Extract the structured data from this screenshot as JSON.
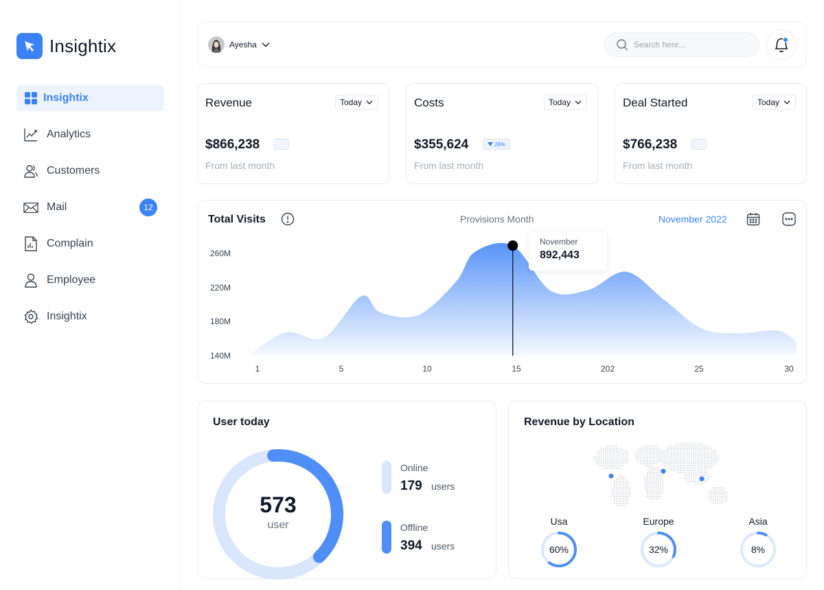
{
  "app": {
    "title": "Insightix"
  },
  "sidebar": {
    "items": [
      {
        "label": "Insightix",
        "icon": "grid-icon",
        "active": true
      },
      {
        "label": "Analytics",
        "icon": "chart-line-icon"
      },
      {
        "label": "Customers",
        "icon": "users-icon"
      },
      {
        "label": "Mail",
        "icon": "mail-icon",
        "badge": "12"
      },
      {
        "label": "Complain",
        "icon": "document-icon"
      },
      {
        "label": "Employee",
        "icon": "user-icon"
      },
      {
        "label": "Insightix",
        "icon": "gear-icon"
      }
    ]
  },
  "topbar": {
    "user_name": "Ayesha",
    "search_placeholder": "Search here..."
  },
  "stats": [
    {
      "title": "Revenue",
      "period": "Today",
      "value": "$866,238",
      "change": "",
      "note": "From last month"
    },
    {
      "title": "Costs",
      "period": "Today",
      "value": "$355,624",
      "change": "28%",
      "note": "From last month"
    },
    {
      "title": "Deal Started",
      "period": "Today",
      "value": "$766,238",
      "change": "",
      "note": "From last month"
    }
  ],
  "visits": {
    "title": "Total Visits",
    "subtitle": "Provisions Month",
    "month": "November 2022",
    "tooltip": {
      "label": "November",
      "value": "892,443"
    }
  },
  "chart_data": {
    "type": "area",
    "title": "Total Visits",
    "x_tick_labels": [
      "1",
      "5",
      "10",
      "15",
      "202",
      "25",
      "30"
    ],
    "y_tick_labels": [
      "260M",
      "220M",
      "180M",
      "140M"
    ],
    "ylim": [
      140,
      270
    ],
    "x": [
      1,
      3,
      5,
      7,
      8,
      10,
      12,
      13,
      15,
      17,
      19,
      21,
      23,
      25,
      27,
      29,
      30
    ],
    "values": [
      140,
      166,
      160,
      206,
      188,
      185,
      222,
      255,
      262,
      212,
      213,
      233,
      202,
      170,
      165,
      168,
      155
    ],
    "highlight": {
      "x": 15,
      "y": 262
    },
    "color": "#4f8ef7"
  },
  "users_today": {
    "title": "User today",
    "total": "573",
    "unit": "user",
    "online": {
      "label": "Online",
      "value": "179",
      "unit": "users",
      "color": "#d9e6fb"
    },
    "offline": {
      "label": "Offline",
      "value": "394",
      "unit": "users",
      "color": "#4f8ef7"
    },
    "offline_fraction": 0.39
  },
  "location": {
    "title": "Revenue by Location",
    "regions": [
      {
        "name": "Usa",
        "percent": "60%",
        "fraction": 0.6
      },
      {
        "name": "Europe",
        "percent": "32%",
        "fraction": 0.32
      },
      {
        "name": "Asia",
        "percent": "8%",
        "fraction": 0.08
      }
    ]
  },
  "colors": {
    "accent": "#3b82f6",
    "light": "#dbe8fd"
  }
}
